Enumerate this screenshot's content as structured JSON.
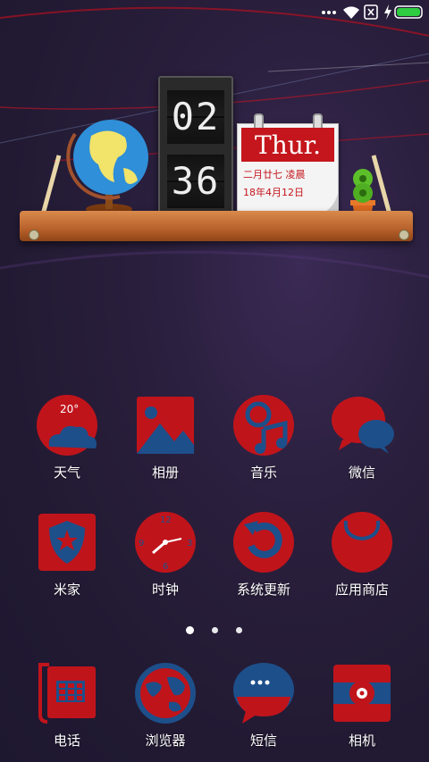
{
  "status_bar": {
    "icons": [
      "dots-icon",
      "wifi-icon",
      "sim-off-icon",
      "charging-icon",
      "battery-icon"
    ]
  },
  "widget": {
    "clock": {
      "hours": "02",
      "minutes": "36"
    },
    "calendar": {
      "weekday": "Thur.",
      "lunar": "二月廿七  凌晨",
      "date": "18年4月12日"
    }
  },
  "apps": [
    {
      "label": "天气",
      "temp": "20°",
      "icon": "weather-icon"
    },
    {
      "label": "相册",
      "icon": "gallery-icon"
    },
    {
      "label": "音乐",
      "icon": "music-icon"
    },
    {
      "label": "微信",
      "icon": "wechat-icon"
    },
    {
      "label": "米家",
      "icon": "mijia-icon"
    },
    {
      "label": "时钟",
      "icon": "clock-icon",
      "clock_numbers": [
        "12",
        "3",
        "6",
        "9"
      ]
    },
    {
      "label": "系统更新",
      "icon": "update-icon"
    },
    {
      "label": "应用商店",
      "icon": "app-store-icon"
    }
  ],
  "dock": [
    {
      "label": "电话",
      "icon": "phone-icon"
    },
    {
      "label": "浏览器",
      "icon": "browser-icon"
    },
    {
      "label": "短信",
      "icon": "messages-icon"
    },
    {
      "label": "相机",
      "icon": "camera-icon"
    }
  ],
  "page_indicator": {
    "count": 3,
    "active": 0
  },
  "colors": {
    "icon_red": "#c0141b",
    "icon_blue": "#1d4f8a",
    "battery_green": "#2ecc40"
  }
}
